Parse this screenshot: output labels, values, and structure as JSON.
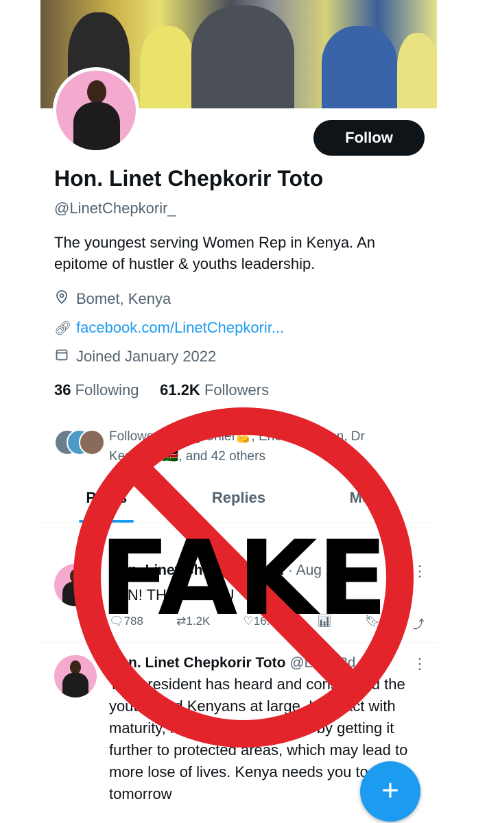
{
  "profile": {
    "follow_label": "Follow",
    "name": "Hon. Linet Chepkorir Toto",
    "handle": "@LinetChepkorir_",
    "bio": "The youngest serving Women Rep in Kenya. An epitome of hustler & youths leadership.",
    "location": "Bomet, Kenya",
    "website": "facebook.com/LinetChepkorir...",
    "joined": "Joined January 2022",
    "following_count": "36",
    "following_label": "Following",
    "followers_count": "61.2K",
    "followers_label": "Followers",
    "followed_by": "Followed by Big Chief💪, Enoch Women, Dr Kenny🇰🇪🇰🇪, and 42 others"
  },
  "tabs": [
    "Posts",
    "Replies",
    "Media"
  ],
  "posts": [
    {
      "author": "Hon. Linet Chepkorir To...",
      "meta": "· Aug 22",
      "text": "WIN! THANK YOU",
      "replies": "788",
      "reposts": "1.2K",
      "likes": "16.1K"
    },
    {
      "author": "Hon. Linet Chepkorir Toto",
      "meta": "@Lin... 2d",
      "text": "The president has heard and considered the youths and Kenyans at large. Let's act with maturity, not to lose more lives by getting it further to protected areas, which may lead to more lose of lives. Kenya needs you today, tomorrow"
    }
  ],
  "overlay": {
    "text": "FAKE",
    "color": "#e3242b"
  },
  "icons": {
    "location": "location-pin-icon",
    "link": "link-icon",
    "calendar": "calendar-icon",
    "pin": "pin-icon",
    "more": "more-dots-icon",
    "reply": "reply-icon",
    "repost": "repost-icon",
    "like": "heart-icon",
    "views": "views-icon",
    "bookmark": "bookmark-icon",
    "share": "share-icon",
    "compose": "compose-plus-icon"
  },
  "colors": {
    "accent": "#1d9bf0",
    "text": "#0f1419",
    "muted": "#536471"
  }
}
